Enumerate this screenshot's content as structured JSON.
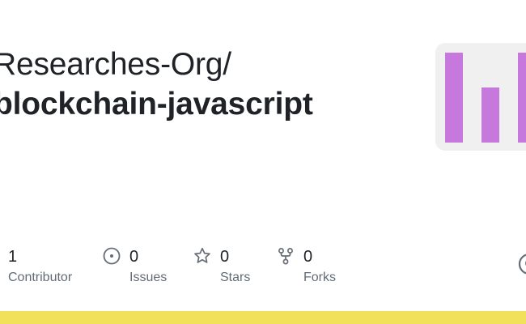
{
  "repo": {
    "owner": "Researches-Org/",
    "name": "blockchain-javascript"
  },
  "language_card": {
    "bar_color": "#c678dd",
    "background": "#f0f0f1",
    "bars": [
      {
        "level": 0.85
      },
      {
        "level": 0.52
      },
      {
        "level": 0.85
      }
    ]
  },
  "stats": [
    {
      "value": "1",
      "label": "Contributor",
      "icon": "contributor-icon"
    },
    {
      "value": "0",
      "label": "Issues",
      "icon": "issue-opened-icon"
    },
    {
      "value": "0",
      "label": "Stars",
      "icon": "star-icon"
    },
    {
      "value": "0",
      "label": "Forks",
      "icon": "repo-forked-icon"
    }
  ],
  "edge_logo_icon": "github-mark-icon",
  "colors": {
    "text": "#1f2328",
    "muted": "#636c76",
    "icon": "#656d76",
    "stripe": "#f1e05a"
  }
}
